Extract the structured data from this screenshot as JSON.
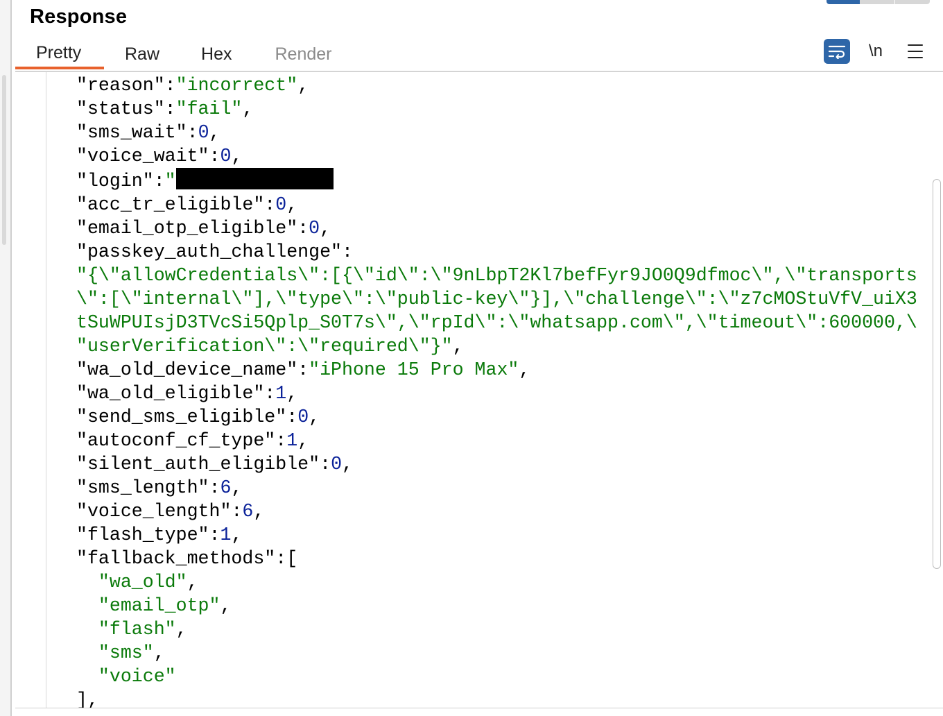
{
  "header": {
    "title": "Response"
  },
  "tabs": [
    {
      "label": "Pretty",
      "active": true
    },
    {
      "label": "Raw"
    },
    {
      "label": "Hex"
    },
    {
      "label": "Render",
      "disabled": true
    }
  ],
  "toolbar": {
    "wrap_icon": "wrap-lines-icon",
    "newline_label": "\\n",
    "menu_icon": "hamburger-menu-icon"
  },
  "colors": {
    "accent": "#e8612c",
    "button_bg": "#2e66a8",
    "string": "#0a7a0a",
    "number": "#0b2299"
  },
  "code_lines": [
    [
      {
        "c": "k",
        "t": "\"reason\":"
      },
      {
        "c": "s",
        "t": "\"incorrect\""
      },
      {
        "c": "k",
        "t": ","
      }
    ],
    [
      {
        "c": "k",
        "t": "\"status\":"
      },
      {
        "c": "s",
        "t": "\"fail\""
      },
      {
        "c": "k",
        "t": ","
      }
    ],
    [
      {
        "c": "k",
        "t": "\"sms_wait\":"
      },
      {
        "c": "n",
        "t": "0"
      },
      {
        "c": "k",
        "t": ","
      }
    ],
    [
      {
        "c": "k",
        "t": "\"voice_wait\":"
      },
      {
        "c": "n",
        "t": "0"
      },
      {
        "c": "k",
        "t": ","
      }
    ],
    [
      {
        "c": "k",
        "t": "\"login\":"
      },
      {
        "c": "s",
        "t": "\""
      },
      {
        "c": "redact",
        "t": ""
      }
    ],
    [
      {
        "c": "k",
        "t": "\"acc_tr_eligible\":"
      },
      {
        "c": "n",
        "t": "0"
      },
      {
        "c": "k",
        "t": ","
      }
    ],
    [
      {
        "c": "k",
        "t": "\"email_otp_eligible\":"
      },
      {
        "c": "n",
        "t": "0"
      },
      {
        "c": "k",
        "t": ","
      }
    ],
    [
      {
        "c": "k",
        "t": "\"passkey_auth_challenge\":"
      }
    ],
    [
      {
        "c": "s",
        "t": "\"{\\\"allowCredentials\\\":[{\\\"id\\\":\\\"9nLbpT2Kl7befFyr9JO0Q9dfmoc\\\",\\\"transports"
      }
    ],
    [
      {
        "c": "s",
        "t": "\\\":[\\\"internal\\\"],\\\"type\\\":\\\"public-key\\\"}],\\\"challenge\\\":\\\"z7cMOStuVfV_uiX3"
      }
    ],
    [
      {
        "c": "s",
        "t": "tSuWPUIsjD3TVcSi5Qplp_S0T7s\\\",\\\"rpId\\\":\\\"whatsapp.com\\\",\\\"timeout\\\":600000,\\"
      }
    ],
    [
      {
        "c": "s",
        "t": "\"userVerification\\\":\\\"required\\\"}\""
      },
      {
        "c": "k",
        "t": ","
      }
    ],
    [
      {
        "c": "k",
        "t": "\"wa_old_device_name\":"
      },
      {
        "c": "s",
        "t": "\"iPhone 15 Pro Max\""
      },
      {
        "c": "k",
        "t": ","
      }
    ],
    [
      {
        "c": "k",
        "t": "\"wa_old_eligible\":"
      },
      {
        "c": "n",
        "t": "1"
      },
      {
        "c": "k",
        "t": ","
      }
    ],
    [
      {
        "c": "k",
        "t": "\"send_sms_eligible\":"
      },
      {
        "c": "n",
        "t": "0"
      },
      {
        "c": "k",
        "t": ","
      }
    ],
    [
      {
        "c": "k",
        "t": "\"autoconf_cf_type\":"
      },
      {
        "c": "n",
        "t": "1"
      },
      {
        "c": "k",
        "t": ","
      }
    ],
    [
      {
        "c": "k",
        "t": "\"silent_auth_eligible\":"
      },
      {
        "c": "n",
        "t": "0"
      },
      {
        "c": "k",
        "t": ","
      }
    ],
    [
      {
        "c": "k",
        "t": "\"sms_length\":"
      },
      {
        "c": "n",
        "t": "6"
      },
      {
        "c": "k",
        "t": ","
      }
    ],
    [
      {
        "c": "k",
        "t": "\"voice_length\":"
      },
      {
        "c": "n",
        "t": "6"
      },
      {
        "c": "k",
        "t": ","
      }
    ],
    [
      {
        "c": "k",
        "t": "\"flash_type\":"
      },
      {
        "c": "n",
        "t": "1"
      },
      {
        "c": "k",
        "t": ","
      }
    ],
    [
      {
        "c": "k",
        "t": "\"fallback_methods\":["
      }
    ],
    [
      {
        "c": "k",
        "t": "  "
      },
      {
        "c": "s",
        "t": "\"wa_old\""
      },
      {
        "c": "k",
        "t": ","
      }
    ],
    [
      {
        "c": "k",
        "t": "  "
      },
      {
        "c": "s",
        "t": "\"email_otp\""
      },
      {
        "c": "k",
        "t": ","
      }
    ],
    [
      {
        "c": "k",
        "t": "  "
      },
      {
        "c": "s",
        "t": "\"flash\""
      },
      {
        "c": "k",
        "t": ","
      }
    ],
    [
      {
        "c": "k",
        "t": "  "
      },
      {
        "c": "s",
        "t": "\"sms\""
      },
      {
        "c": "k",
        "t": ","
      }
    ],
    [
      {
        "c": "k",
        "t": "  "
      },
      {
        "c": "s",
        "t": "\"voice\""
      }
    ],
    [
      {
        "c": "k",
        "t": "],"
      }
    ]
  ]
}
